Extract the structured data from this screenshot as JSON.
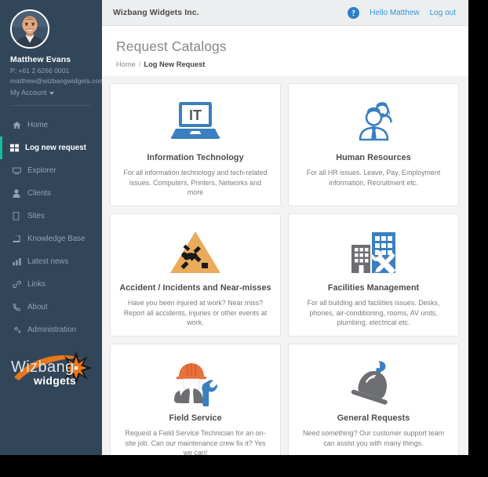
{
  "sidebar": {
    "profile": {
      "avatar_icon": "user-avatar-photo",
      "name": "Matthew Evans",
      "phone": "P: +61 2 6266 0001",
      "email": "matthew@wizbangwidgets.com",
      "account_menu_label": "My Account"
    },
    "items": [
      {
        "label": "Home",
        "icon": "home-icon",
        "active": false
      },
      {
        "label": "Log new request",
        "icon": "grid-icon",
        "active": true
      },
      {
        "label": "Explorer",
        "icon": "desktop-icon",
        "active": false
      },
      {
        "label": "Clients",
        "icon": "user-icon",
        "active": false
      },
      {
        "label": "Sites",
        "icon": "tablet-icon",
        "active": false
      },
      {
        "label": "Knowledge Base",
        "icon": "book-icon",
        "active": false
      },
      {
        "label": "Latest news",
        "icon": "bar-chart-icon",
        "active": false
      },
      {
        "label": "Links",
        "icon": "link-icon",
        "active": false
      },
      {
        "label": "About",
        "icon": "phone-icon",
        "active": false
      },
      {
        "label": "Administration",
        "icon": "cogs-icon",
        "active": false
      }
    ],
    "logo": {
      "primary_text": "Wizbang",
      "secondary_text": "widgets",
      "star_color": "#e8761a",
      "swoosh_color": "#e8761a"
    }
  },
  "header": {
    "brand": "Wizbang Widgets Inc.",
    "help_icon": "help-circle-icon",
    "greeting": "Hello Matthew",
    "logout": "Log out",
    "link_color": "#3498db"
  },
  "page": {
    "title": "Request Catalogs",
    "breadcrumb": {
      "home": "Home",
      "separator": "/",
      "current": "Log New Request"
    }
  },
  "catalogs": [
    {
      "icon": "laptop-it-icon",
      "icon_text": "IT",
      "title": "Information Technology",
      "description": "For all information technology and tech-related issues. Computers, Printers, Networks and more"
    },
    {
      "icon": "people-hr-icon",
      "title": "Human Resources",
      "description": "For all HR issues. Leave, Pay, Employment information, Recruitment etc."
    },
    {
      "icon": "warning-triangle-slip-icon",
      "title": "Accident / Incidents and Near-misses",
      "description": "Have you been injured at work? Near miss? Report all accidents, injuries or other events at work."
    },
    {
      "icon": "buildings-tools-icon",
      "title": "Facilities Management",
      "description": "For all building and facilities issues. Desks, phones, air-conditioning, rooms, AV units, plumbing, electrical etc."
    },
    {
      "icon": "worker-hardhat-wrench-icon",
      "title": "Field Service",
      "description": "Request a Field Service Technician for an on-site job. Can our maintenance crew fix it? Yes we can!"
    },
    {
      "icon": "service-bell-icon",
      "title": "General Requests",
      "description": "Need something? Our customer support team can assist you with many things."
    }
  ],
  "theme": {
    "sidebar_bg": "#32465a",
    "active_marker": "#1abc9c",
    "page_bg": "#f3f3f3",
    "icon_blue": "#3a7fbf",
    "icon_grey": "#6d6e71",
    "icon_orange": "#e8a44c"
  }
}
